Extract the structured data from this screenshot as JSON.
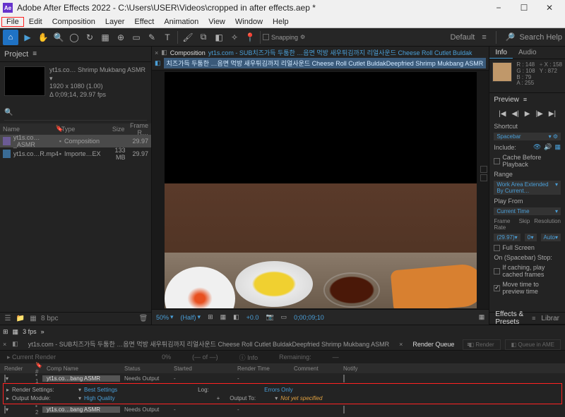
{
  "titlebar": {
    "logo": "Ae",
    "title": "Adobe After Effects 2022 - C:\\Users\\USER\\Videos\\cropped in after effects.aep *"
  },
  "menubar": [
    "File",
    "Edit",
    "Composition",
    "Layer",
    "Effect",
    "Animation",
    "View",
    "Window",
    "Help"
  ],
  "toolbar": {
    "snapping": "Snapping",
    "workspace": "Default",
    "search_placeholder": "Search Help"
  },
  "project": {
    "tab": "Project",
    "selected_name": "yt1s.co… Shrimp Mukbang ASMR ▾",
    "dims": "1920 x 1080 (1.00)",
    "duration": "Δ 0;09;14, 29.97 fps",
    "search_icon": "🔍",
    "headers": {
      "name": "Name",
      "type": "Type",
      "size": "Size",
      "frame": "Frame R…"
    },
    "rows": [
      {
        "name": "yt1s.co…_ASMR",
        "type": "Composition",
        "size": "",
        "frame": "29.97"
      },
      {
        "name": "yt1s.co…R.mp4",
        "type": "Importe…EX",
        "size": "133 MB",
        "frame": "29.97"
      }
    ],
    "bpc": "8 bpc"
  },
  "composition": {
    "header_label": "Composition",
    "tab1": "yt1s.com - SUB치즈가득 두툼한 …음면 먹방 새우튀김까지 리얼사운드 Cheese Roll Cutlet Buldak",
    "tab2": "치즈가득 두툼한 …음면 먹방 새우튀김까지 리얼사운드 Cheese Roll Cutlet BuldakDeepfried Shrimp Mukbang ASMR",
    "footer": {
      "zoom": "50%",
      "res": "(Half)",
      "camera": "⊞",
      "mask": "◧",
      "time": "0;00;09;10",
      "plus": "+0.0"
    }
  },
  "info": {
    "tabs": [
      "Info",
      "Audio"
    ],
    "rgb": {
      "r": "R : 148",
      "g": "G : 108",
      "b": "B : 79",
      "a": "A : 255"
    },
    "xy": {
      "x": "X : 158",
      "y": "Y : 872"
    }
  },
  "preview": {
    "title": "Preview",
    "shortcut_label": "Shortcut",
    "shortcut": "Spacebar",
    "include_label": "Include:",
    "cache_before": "Cache Before Playback",
    "range_label": "Range",
    "range": "Work Area Extended By Current…",
    "playfrom_label": "Play From",
    "playfrom": "Current Time",
    "framerate_label": "Frame Rate",
    "skip_label": "Skip",
    "resolution_label": "Resolution",
    "framerate": "(29.97)",
    "skip": "0",
    "resolution": "Auto",
    "fullscreen": "Full Screen",
    "spacebar_stop": "On (Spacebar) Stop:",
    "if_caching": "If caching, play cached frames",
    "move_time": "Move time to preview time"
  },
  "effects": {
    "tab1": "Effects & Presets",
    "tab2": "Librar"
  },
  "timeline": {
    "fps": "3 fps"
  },
  "render_queue": {
    "comp_tab": "yt1s.com - SUB치즈가득 두툼한 …음면 먹방 새우튀김까지 리얼사운드 Cheese Roll Cutlet BuldakDeepfried Shrimp Mukbang ASMR",
    "rq_tab": "Render Queue",
    "current": "Current Render",
    "pct": "0%",
    "of": "(—  of —)",
    "info": "Info",
    "remaining": "Remaining:",
    "render_btn": "Render",
    "ame_btn": "Queue in AME",
    "headers": {
      "render": "Render",
      "num": "#",
      "name": "Comp Name",
      "status": "Status",
      "started": "Started",
      "rtime": "Render Time",
      "comment": "Comment",
      "notify": "Notify"
    },
    "row1": {
      "num": "1",
      "name": "yt1s.co…bang ASMR",
      "status": "Needs Output",
      "started": "-"
    },
    "settings": {
      "rs_label": "Render Settings:",
      "rs_val": "Best Settings",
      "om_label": "Output Module:",
      "om_val": "High Quality",
      "log_label": "Log:",
      "log_val": "Errors Only",
      "out_label": "Output To:",
      "out_val": "Not yet specified"
    },
    "row2": {
      "num": "2",
      "name": "yt1s.co…bang ASMR",
      "status": "Needs Output",
      "started": "-"
    }
  }
}
